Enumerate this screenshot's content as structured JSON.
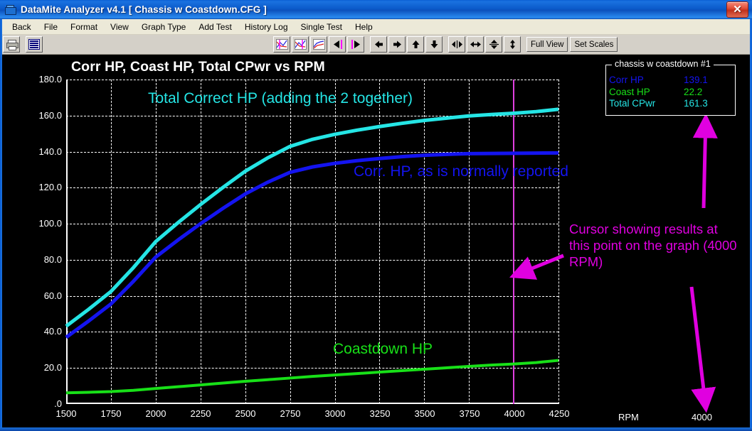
{
  "window": {
    "title": "DataMite Analyzer v4.1  [ Chassis w Coastdown.CFG ]",
    "app_icon": "folder-icon",
    "close_label": "✕"
  },
  "menu": {
    "items": [
      {
        "label": "Back"
      },
      {
        "label": "File"
      },
      {
        "label": "Format"
      },
      {
        "label": "View"
      },
      {
        "label": "Graph Type"
      },
      {
        "label": "Add Test"
      },
      {
        "label": "History Log"
      },
      {
        "label": "Single Test"
      },
      {
        "label": "Help"
      }
    ]
  },
  "toolbar": {
    "buttons": [
      {
        "name": "print-icon",
        "type": "icon"
      },
      {
        "name": "report-icon",
        "type": "icon"
      },
      {
        "name": "graph-cursor-left-icon",
        "type": "icon"
      },
      {
        "name": "graph-cursor-right-icon",
        "type": "icon"
      },
      {
        "name": "graph-plain-icon",
        "type": "icon"
      },
      {
        "name": "cursor-step-left-icon",
        "type": "icon"
      },
      {
        "name": "cursor-step-right-icon",
        "type": "icon"
      },
      {
        "name": "pan-left-icon",
        "type": "icon"
      },
      {
        "name": "pan-right-icon",
        "type": "icon"
      },
      {
        "name": "pan-up-icon",
        "type": "icon"
      },
      {
        "name": "pan-down-icon",
        "type": "icon"
      },
      {
        "name": "zoom-in-horizontal-icon",
        "type": "icon"
      },
      {
        "name": "zoom-out-horizontal-icon",
        "type": "icon"
      },
      {
        "name": "zoom-in-vertical-icon",
        "type": "icon"
      },
      {
        "name": "zoom-out-vertical-icon",
        "type": "icon"
      }
    ],
    "full_view_label": "Full View",
    "set_scales_label": "Set Scales"
  },
  "legend": {
    "title": "chassis w coastdown   #1",
    "rows": [
      {
        "name": "Corr HP",
        "value": "139.1",
        "color": "#1414f0"
      },
      {
        "name": "Coast HP",
        "value": "22.2",
        "color": "#18e018"
      },
      {
        "name": "Total CPwr",
        "value": "161.3",
        "color": "#25e5e5"
      }
    ]
  },
  "annotations": {
    "total_hp": "Total Correct HP (adding the 2 together)",
    "corr_hp": "Corr. HP, as is normally reported",
    "coastdown": "Coastdown HP",
    "cursor_note": "Cursor showing results at this point on the graph (4000 RPM)"
  },
  "axis_footer": {
    "rpm_label": "RPM",
    "rpm_value": "4000"
  },
  "colors": {
    "corr_hp": "#1414f0",
    "coast_hp": "#18e018",
    "total_cpwr": "#25e5e5",
    "cursor": "#e040e0",
    "annotation": "#e000e0",
    "background": "#000000",
    "grid": "#ffffff"
  },
  "chart_data": {
    "type": "line",
    "title": "Corr HP, Coast HP, Total CPwr vs RPM",
    "xlabel": "RPM",
    "ylabel": "",
    "xlim": [
      1500,
      4250
    ],
    "ylim": [
      0,
      180
    ],
    "xticks": [
      1500,
      1750,
      2000,
      2250,
      2500,
      2750,
      3000,
      3250,
      3500,
      3750,
      4000,
      4250
    ],
    "xticklabels": [
      "1500",
      "1750",
      "2000",
      "2250",
      "2500",
      "2750",
      "3000",
      "3250",
      "3500",
      "3750",
      "4000",
      "4250"
    ],
    "yticks": [
      0,
      20,
      40,
      60,
      80,
      100,
      120,
      140,
      160,
      180
    ],
    "yticklabels": [
      ".0",
      "20.0",
      "40.0",
      "60.0",
      "80.0",
      "100.0",
      "120.0",
      "140.0",
      "160.0",
      "180.0"
    ],
    "grid": true,
    "legend_position": "top-right-outside",
    "cursor_x": 4000,
    "x": [
      1500,
      1625,
      1750,
      1875,
      2000,
      2125,
      2250,
      2375,
      2500,
      2625,
      2750,
      2875,
      3000,
      3125,
      3250,
      3375,
      3500,
      3625,
      3750,
      3875,
      4000,
      4125,
      4250
    ],
    "series": [
      {
        "name": "Corr HP",
        "color": "#1414f0",
        "values": [
          37.0,
          46.0,
          55.5,
          68.0,
          81.5,
          91.0,
          100.0,
          108.5,
          116.5,
          123.0,
          128.5,
          131.5,
          133.5,
          135.0,
          136.2,
          137.2,
          138.0,
          138.5,
          138.9,
          139.0,
          139.1,
          139.2,
          139.3
        ]
      },
      {
        "name": "Coast HP",
        "color": "#18e018",
        "values": [
          6.2,
          6.5,
          6.9,
          7.6,
          8.6,
          9.6,
          10.6,
          11.6,
          12.6,
          13.5,
          14.4,
          15.3,
          16.1,
          16.9,
          17.7,
          18.5,
          19.3,
          20.1,
          20.9,
          21.6,
          22.2,
          23.0,
          24.2
        ]
      },
      {
        "name": "Total CPwr",
        "color": "#25e5e5",
        "values": [
          43.2,
          52.5,
          62.4,
          75.6,
          90.1,
          100.6,
          110.6,
          120.1,
          129.1,
          136.5,
          142.9,
          146.8,
          149.6,
          151.9,
          153.9,
          155.7,
          157.3,
          158.6,
          159.8,
          160.6,
          161.3,
          162.2,
          163.5
        ]
      }
    ]
  }
}
